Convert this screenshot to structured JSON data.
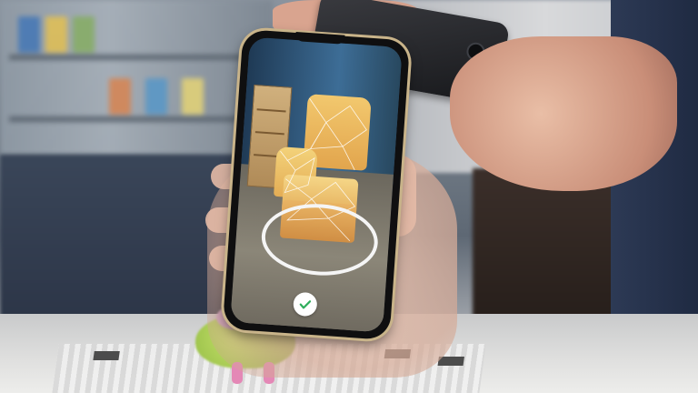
{
  "scene": {
    "colors": {
      "phone_frame": "#c9b48a",
      "scan_ring": "#f5f5f5",
      "check_green": "#2fae5c",
      "armchair": "#f2c86e",
      "mesh_lines": "#ffffff"
    }
  },
  "ar_app": {
    "confirm_icon": "checkmark-icon",
    "scan_target_icon": "placement-ring-icon"
  }
}
